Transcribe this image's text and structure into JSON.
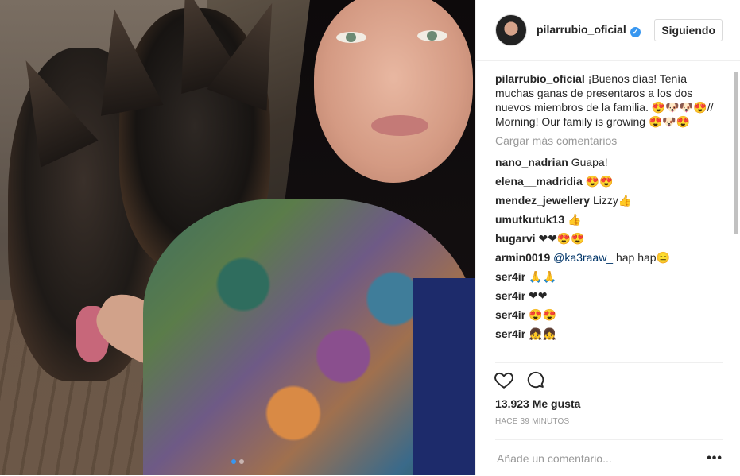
{
  "post": {
    "username": "pilarrubio_oficial",
    "verified": true,
    "follow_label": "Siguiendo",
    "caption_user": "pilarrubio_oficial",
    "caption_text": "¡Buenos días! Tenía muchas ganas de presentaros a los dos nuevos miembros de la familia. 😍🐶🐶😍// Morning! Our family is growing 😍🐶😍",
    "load_more": "Cargar más comentarios",
    "comments": [
      {
        "user": "nano_nadrian",
        "text": "Guapa!"
      },
      {
        "user": "elena__madridia",
        "text": "😍😍"
      },
      {
        "user": "mendez_jewellery",
        "text": "Lizzy👍"
      },
      {
        "user": "umutkutuk13",
        "text": "👍"
      },
      {
        "user": "hugarvi",
        "text": "❤❤😍😍"
      },
      {
        "user": "armin0019",
        "mention": "@ka3raaw_",
        "text": "hap hap😑"
      },
      {
        "user": "ser4ir",
        "text": "🙏🙏"
      },
      {
        "user": "ser4ir",
        "text": "❤❤"
      },
      {
        "user": "ser4ir",
        "text": "😍😍"
      },
      {
        "user": "ser4ir",
        "text": "👧👧"
      }
    ],
    "likes": "13.923 Me gusta",
    "time": "HACE 39 MINUTOS",
    "add_comment_placeholder": "Añade un comentario...",
    "more_options": "•••",
    "icons": {
      "like": "heart-outline-icon",
      "comment": "comment-bubble-icon",
      "verified": "verified-badge-icon"
    },
    "colors": {
      "accent": "#3897f0",
      "muted": "#999999",
      "border": "#efefef"
    },
    "carousel": {
      "count": 2,
      "active": 0
    }
  }
}
